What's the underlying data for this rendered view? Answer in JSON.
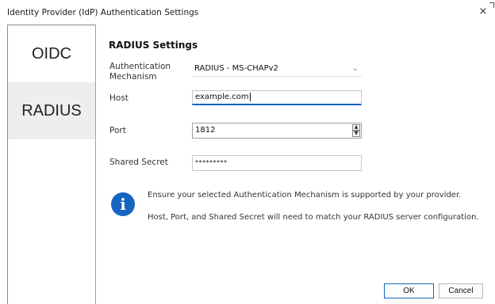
{
  "window": {
    "title": "Identity Provider (IdP) Authentication Settings",
    "close_glyph": "×"
  },
  "sidebar": {
    "items": [
      {
        "label": "OIDC",
        "selected": false
      },
      {
        "label": "RADIUS",
        "selected": true
      }
    ]
  },
  "radius": {
    "section_title": "RADIUS Settings",
    "mechanism_label": "Authentication\nMechanism",
    "mechanism_value": "RADIUS - MS-CHAPv2",
    "host_label": "Host",
    "host_value": "example.com",
    "port_label": "Port",
    "port_value": "1812",
    "secret_label": "Shared Secret",
    "secret_value": "*********",
    "info_icon_glyph": "i",
    "info_line1": "Ensure your selected Authentication Mechanism is supported by your provider.",
    "info_line2": "Host, Port, and Shared Secret will need to match your RADIUS server configuration."
  },
  "buttons": {
    "ok": "OK",
    "cancel": "Cancel"
  },
  "colors": {
    "accent": "#1565c0",
    "selected_tab_bg": "#eeeeee"
  }
}
